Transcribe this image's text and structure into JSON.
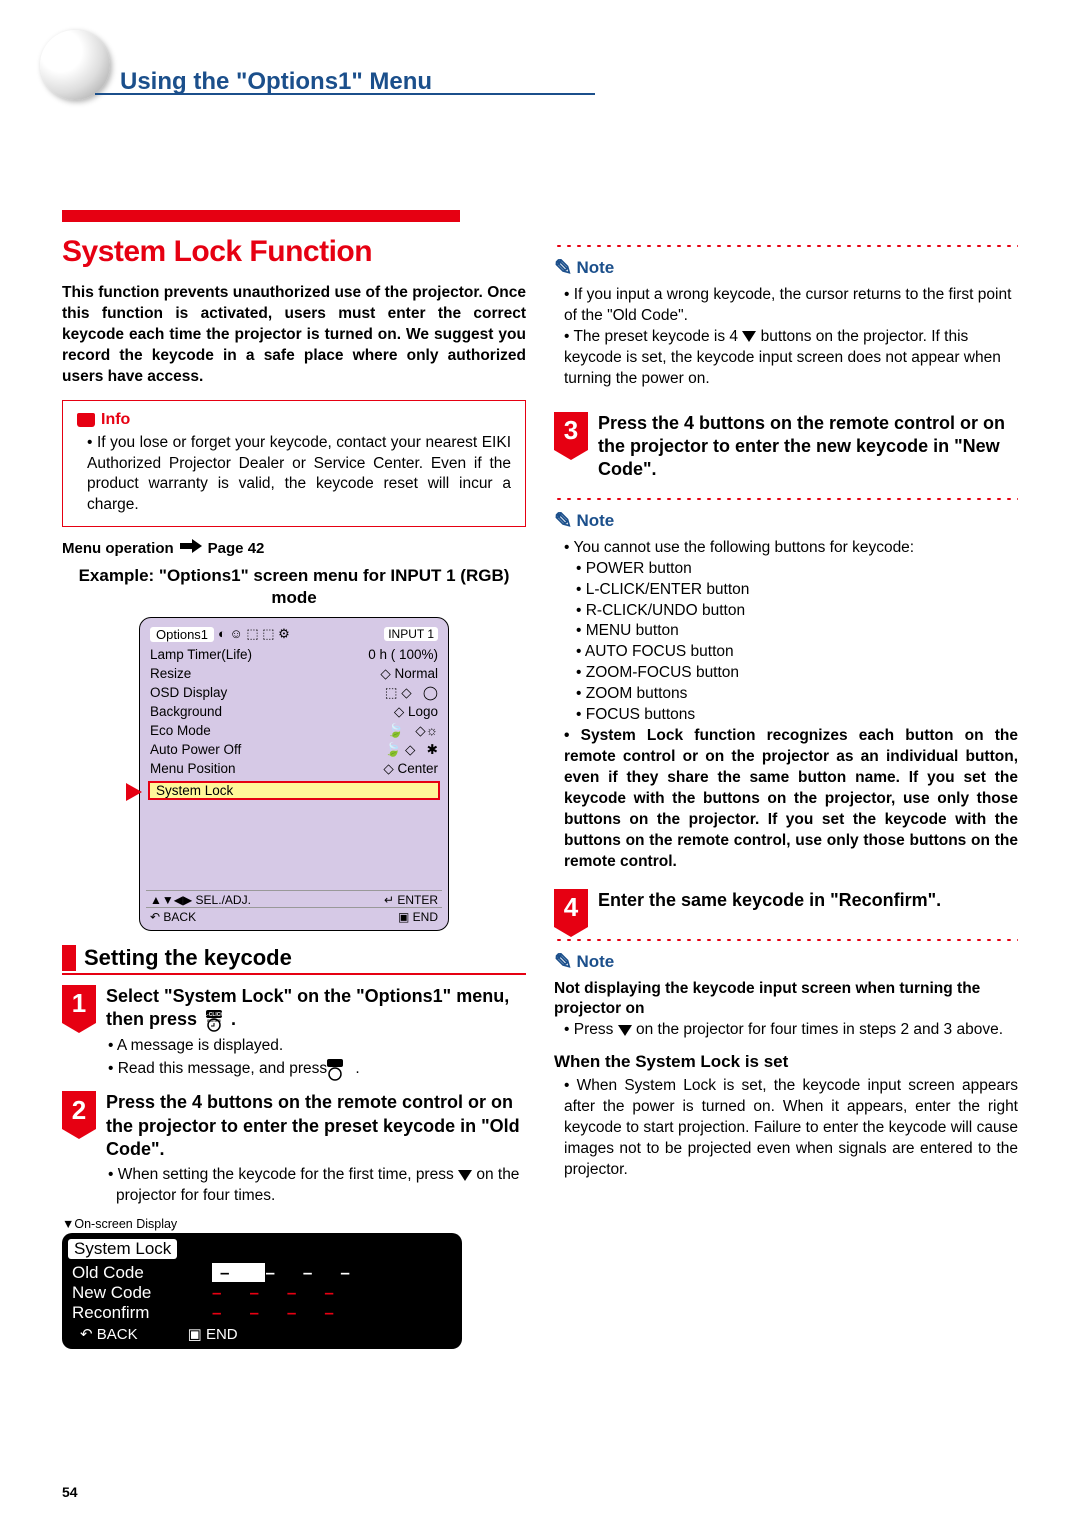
{
  "page_number": "54",
  "header": {
    "title": "Using the \"Options1\" Menu"
  },
  "main": {
    "heading": "System Lock Function",
    "intro": "This function prevents unauthorized use of the projector. Once this function is activated, users must enter the correct keycode each time the projector is turned on. We suggest you record the keycode in a safe place where only authorized users have access.",
    "info": {
      "label": "Info",
      "text": "If you lose or forget your keycode, contact your nearest EIKI Authorized Projector Dealer or Service Center. Even if the product warranty is valid, the keycode reset will incur a charge."
    },
    "menu_op": {
      "label": "Menu operation",
      "page": "Page 42"
    },
    "example_title": "Example: \"Options1\" screen menu for INPUT 1 (RGB) mode",
    "osd": {
      "title": "Options1",
      "input": "INPUT 1",
      "lamptimer": {
        "label": "Lamp Timer(Life)",
        "value": "0 h ( 100%)"
      },
      "rows": [
        {
          "label": "Resize",
          "value": "◇ Normal"
        },
        {
          "label": "OSD Display",
          "value": ""
        },
        {
          "label": "Background",
          "value": "◇ Logo"
        },
        {
          "label": "Eco Mode",
          "value": ""
        },
        {
          "label": "Auto Power Off",
          "value": ""
        },
        {
          "label": "Menu Position",
          "value": "◇ Center"
        }
      ],
      "highlight": "System Lock",
      "footer": {
        "sel": "SEL./ADJ.",
        "enter": "ENTER",
        "back": "BACK",
        "end": "END"
      }
    },
    "section_title": "Setting the keycode",
    "step1": {
      "title_a": "Select \"System Lock\" on the \"Options1\" menu, then press ",
      "bullet1": "A message is displayed.",
      "bullet2": "Read this message, and press "
    },
    "step2": {
      "title": "Press the 4 buttons on the remote control or on the projector to enter the preset keycode in \"Old Code\".",
      "bullet1_a": "When setting the keycode for the first time, press ",
      "bullet1_b": " on the projector for four times."
    },
    "osd_label": "▼On-screen Display",
    "keycode": {
      "title": "System Lock",
      "old": "Old Code",
      "new": "New Code",
      "reconfirm": "Reconfirm",
      "back": "BACK",
      "end": "END"
    }
  },
  "right": {
    "note1": {
      "label": "Note",
      "b1": "If you input a wrong keycode, the cursor returns to the first point of the \"Old Code\".",
      "b2_a": "The preset keycode is 4 ",
      "b2_b": " buttons on the projector. If this keycode is set, the keycode input screen does not appear when turning the power on."
    },
    "step3": {
      "title": "Press the 4 buttons on the remote control or on the projector to enter the new keycode in \"New Code\"."
    },
    "note2": {
      "label": "Note",
      "intro": "You cannot use the following buttons for keycode:",
      "buttons": [
        "POWER button",
        "L-CLICK/ENTER button",
        "R-CLICK/UNDO button",
        "MENU button",
        "AUTO FOCUS button",
        "ZOOM-FOCUS button",
        "ZOOM buttons",
        "FOCUS buttons"
      ],
      "bold": "System Lock function recognizes each button on the remote control or on the projector as an individual button, even if they share the same button name. If you set the keycode with the buttons on the projector, use only those buttons on the projector. If you set the keycode with the buttons on the remote control, use only those buttons on the remote control."
    },
    "step4": {
      "title": "Enter the same keycode in \"Reconfirm\"."
    },
    "note3": {
      "label": "Note",
      "h1": "Not displaying the keycode input screen when turning the projector on",
      "b1_a": "Press ",
      "b1_b": " on the projector for four times in steps 2 and 3 above.",
      "h2": "When the System Lock is set",
      "b2": "When System Lock is set, the keycode input screen appears after the power is turned on. When it appears, enter the right keycode to start projection. Failure to enter the keycode will cause images not to be projected even when signals are entered to the projector."
    }
  }
}
